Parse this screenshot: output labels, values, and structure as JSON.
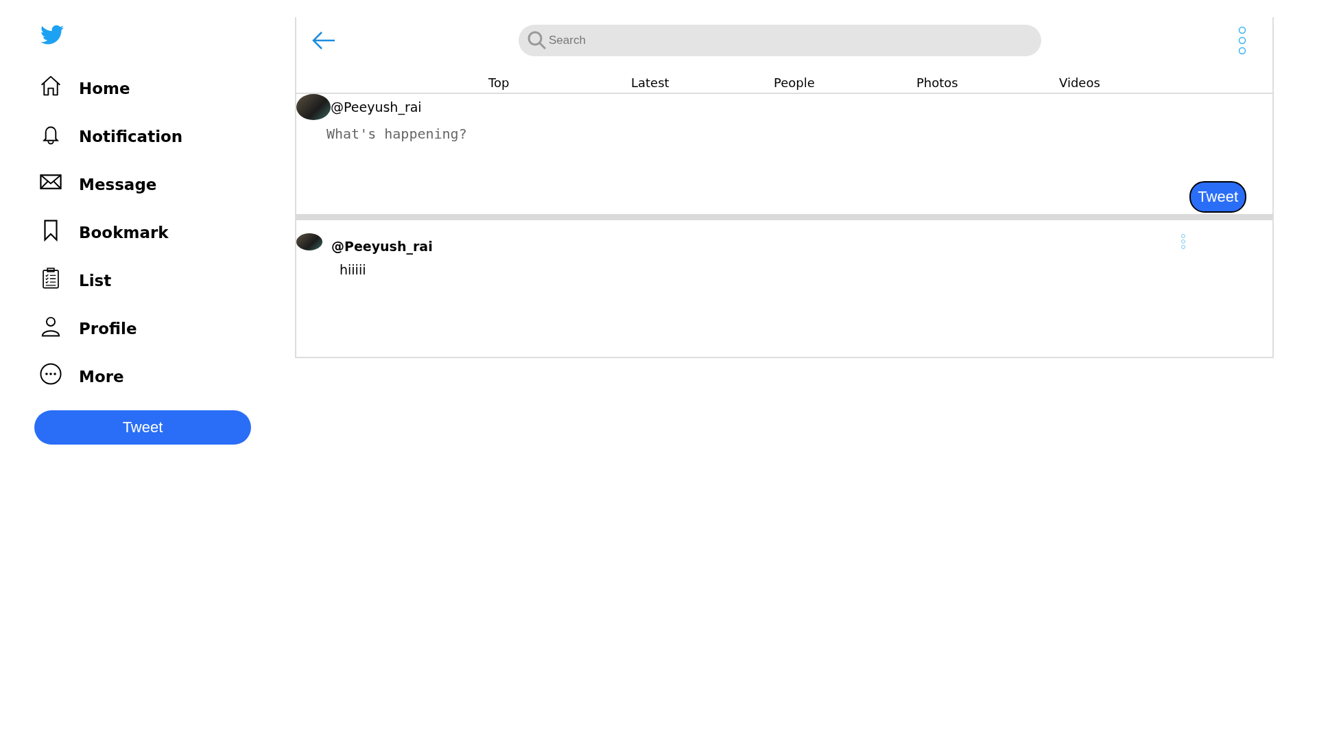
{
  "sidebar": {
    "items": [
      {
        "label": "Home"
      },
      {
        "label": "Notification"
      },
      {
        "label": "Message"
      },
      {
        "label": "Bookmark"
      },
      {
        "label": "List"
      },
      {
        "label": "Profile"
      },
      {
        "label": "More"
      }
    ],
    "button": "Tweet"
  },
  "header": {
    "search": {
      "placeholder": "Search"
    }
  },
  "tabs": [
    {
      "label": "Top"
    },
    {
      "label": "Latest"
    },
    {
      "label": "People"
    },
    {
      "label": "Photos"
    },
    {
      "label": "Videos"
    }
  ],
  "compose": {
    "handle": "@Peeyush_rai",
    "placeholder": "What's happening?",
    "button": "Tweet"
  },
  "posts": [
    {
      "handle": "@Peeyush_rai",
      "text": "hiiiii"
    }
  ]
}
